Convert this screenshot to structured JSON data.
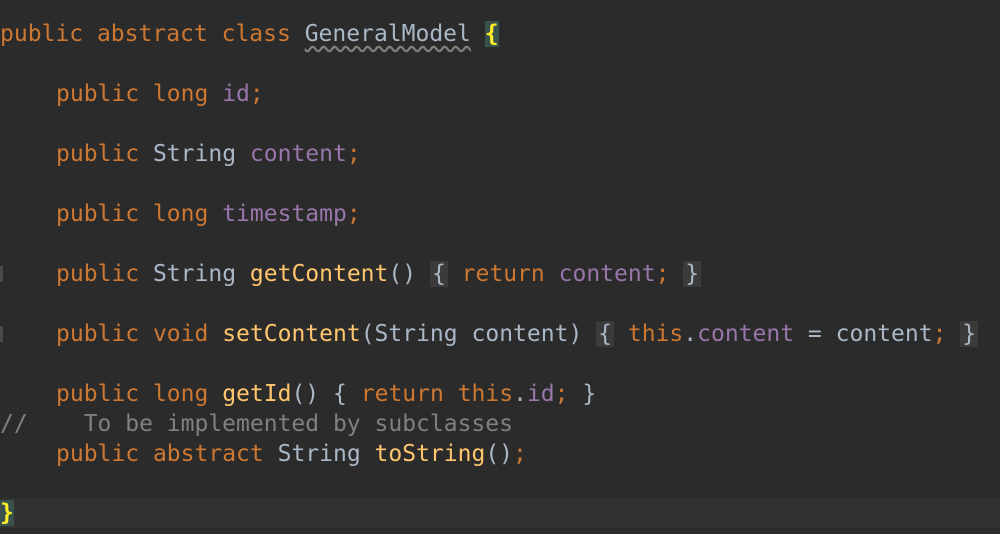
{
  "code": {
    "class_decl": {
      "kw_public": "public",
      "kw_abstract": "abstract",
      "kw_class": "class",
      "class_name": "GeneralModel",
      "open_brace": "{"
    },
    "field_id": {
      "kw_public": "public",
      "type": "long",
      "name": "id",
      "semi": ";"
    },
    "field_content": {
      "kw_public": "public",
      "type": "String",
      "name": "content",
      "semi": ";"
    },
    "field_timestamp": {
      "kw_public": "public",
      "type": "long",
      "name": "timestamp",
      "semi": ";"
    },
    "get_content": {
      "kw_public": "public",
      "type": "String",
      "name": "getContent",
      "parens": "()",
      "open_brace": "{",
      "kw_return": "return",
      "field": "content",
      "semi": ";",
      "close_brace": "}"
    },
    "set_content": {
      "kw_public": "public",
      "kw_void": "void",
      "name": "setContent",
      "open_paren": "(",
      "param_type": "String",
      "param_name": "content",
      "close_paren": ")",
      "open_brace": "{",
      "kw_this": "this",
      "dot": ".",
      "field": "content",
      "assign": "=",
      "value": "content",
      "semi": ";",
      "close_brace": "}"
    },
    "get_id": {
      "kw_public": "public",
      "type": "long",
      "name": "getId",
      "parens": "()",
      "open_brace": "{",
      "kw_return": "return",
      "kw_this": "this",
      "dot": ".",
      "field": "id",
      "semi": ";",
      "close_brace": "}"
    },
    "comment": {
      "marker": "//",
      "text": "To be implemented by subclasses"
    },
    "to_string": {
      "kw_public": "public",
      "kw_abstract": "abstract",
      "type": "String",
      "name": "toString",
      "parens": "()",
      "semi": ";"
    },
    "class_close": {
      "close_brace": "}"
    }
  },
  "colors": {
    "background": "#2b2b2b",
    "keyword": "#cc7832",
    "field": "#9876aa",
    "method": "#ffc66d",
    "plain": "#a9b7c6",
    "comment": "#808080",
    "brace_highlight": "#ffef28"
  }
}
